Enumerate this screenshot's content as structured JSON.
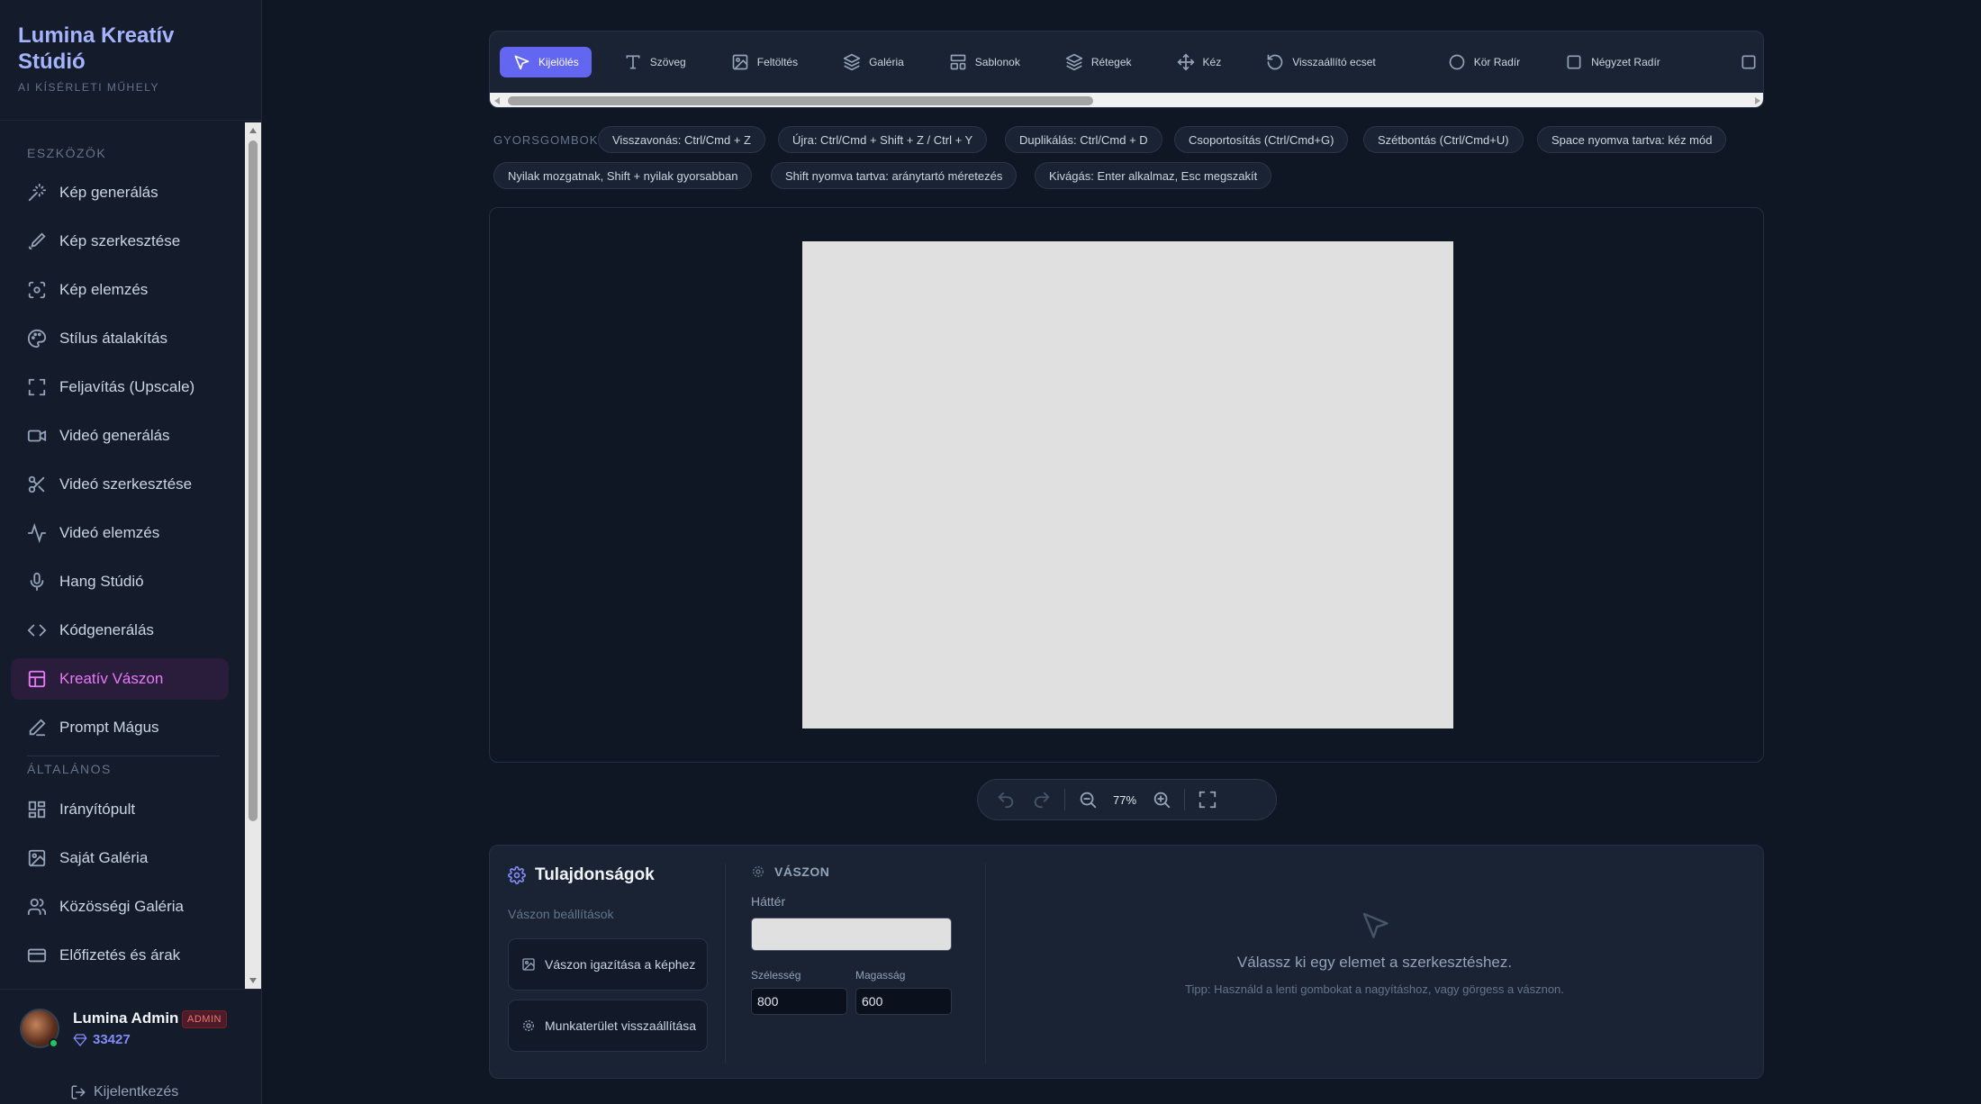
{
  "brand": {
    "title": "Lumina Kreatív Stúdió",
    "subtitle": "AI KÍSÉRLETI MŰHELY"
  },
  "sidebar": {
    "tools_label": "ESZKÖZÖK",
    "general_label": "ÁLTALÁNOS",
    "tools": [
      {
        "label": "Kép generálás",
        "icon": "magic-wand-icon"
      },
      {
        "label": "Kép szerkesztése",
        "icon": "brush-icon"
      },
      {
        "label": "Kép elemzés",
        "icon": "scan-eye-icon"
      },
      {
        "label": "Stílus átalakítás",
        "icon": "palette-icon"
      },
      {
        "label": "Feljavítás (Upscale)",
        "icon": "expand-icon"
      },
      {
        "label": "Videó generálás",
        "icon": "video-icon"
      },
      {
        "label": "Videó szerkesztése",
        "icon": "scissors-icon"
      },
      {
        "label": "Videó elemzés",
        "icon": "activity-icon"
      },
      {
        "label": "Hang Stúdió",
        "icon": "microphone-icon"
      },
      {
        "label": "Kódgenerálás",
        "icon": "code-icon"
      },
      {
        "label": "Kreatív Vászon",
        "icon": "layout-icon"
      },
      {
        "label": "Prompt Mágus",
        "icon": "pencil-icon"
      }
    ],
    "general": [
      {
        "label": "Irányítópult",
        "icon": "dashboard-icon"
      },
      {
        "label": "Saját Galéria",
        "icon": "image-icon"
      },
      {
        "label": "Közösségi Galéria",
        "icon": "users-icon"
      },
      {
        "label": "Előfizetés és árak",
        "icon": "credit-card-icon"
      }
    ],
    "active_item": "Kreatív Vászon"
  },
  "user": {
    "name": "Lumina Admin",
    "badge": "ADMIN",
    "credits": "33427",
    "logout": "Kijelentkezés"
  },
  "toolbar": {
    "tools": [
      {
        "label": "Kijelölés",
        "icon": "pointer-icon",
        "active": true
      },
      {
        "label": "Szöveg",
        "icon": "text-icon"
      },
      {
        "label": "Feltöltés",
        "icon": "image-upload-icon"
      },
      {
        "label": "Galéria",
        "icon": "layers-icon"
      },
      {
        "label": "Sablonok",
        "icon": "template-icon"
      },
      {
        "label": "Rétegek",
        "icon": "layers-icon"
      },
      {
        "label": "Kéz",
        "icon": "move-icon"
      },
      {
        "label": "Visszaállító ecset",
        "icon": "rotate-ccw-icon"
      },
      {
        "label": "Kör Radír",
        "icon": "circle-icon"
      },
      {
        "label": "Négyzet Radír",
        "icon": "square-icon"
      }
    ]
  },
  "shortcuts": {
    "label": "GYORSGOMBOK",
    "items": [
      "Visszavonás: Ctrl/Cmd + Z",
      "Újra: Ctrl/Cmd + Shift + Z / Ctrl + Y",
      "Duplikálás: Ctrl/Cmd + D",
      "Csoportosítás (Ctrl/Cmd+G)",
      "Szétbontás (Ctrl/Cmd+U)",
      "Space nyomva tartva: kéz mód",
      "Nyilak mozgatnak, Shift + nyilak gyorsabban",
      "Shift nyomva tartva: aránytartó méretezés",
      "Kivágás: Enter alkalmaz, Esc megszakít"
    ]
  },
  "zoom": {
    "value": "77%"
  },
  "properties": {
    "title": "Tulajdonságok",
    "subtitle": "Vászon beállítások",
    "fit_button": "Vászon igazítása a képhez",
    "reset_button": "Munkaterület visszaállítása",
    "section": "VÁSZON",
    "background_label": "Háttér",
    "background_color": "#e0e0e0",
    "width_label": "Szélesség",
    "height_label": "Magasság",
    "width_value": "800",
    "height_value": "600",
    "empty_message": "Válassz ki egy elemet a szerkesztéshez.",
    "empty_tip": "Tipp: Használd a lenti gombokat a nagyításhoz, vagy görgess a vásznon."
  },
  "colors": {
    "accent": "#6366f1",
    "active_nav": "#e879f9",
    "canvas": "#e0e0e0",
    "background": "#0f1624"
  }
}
